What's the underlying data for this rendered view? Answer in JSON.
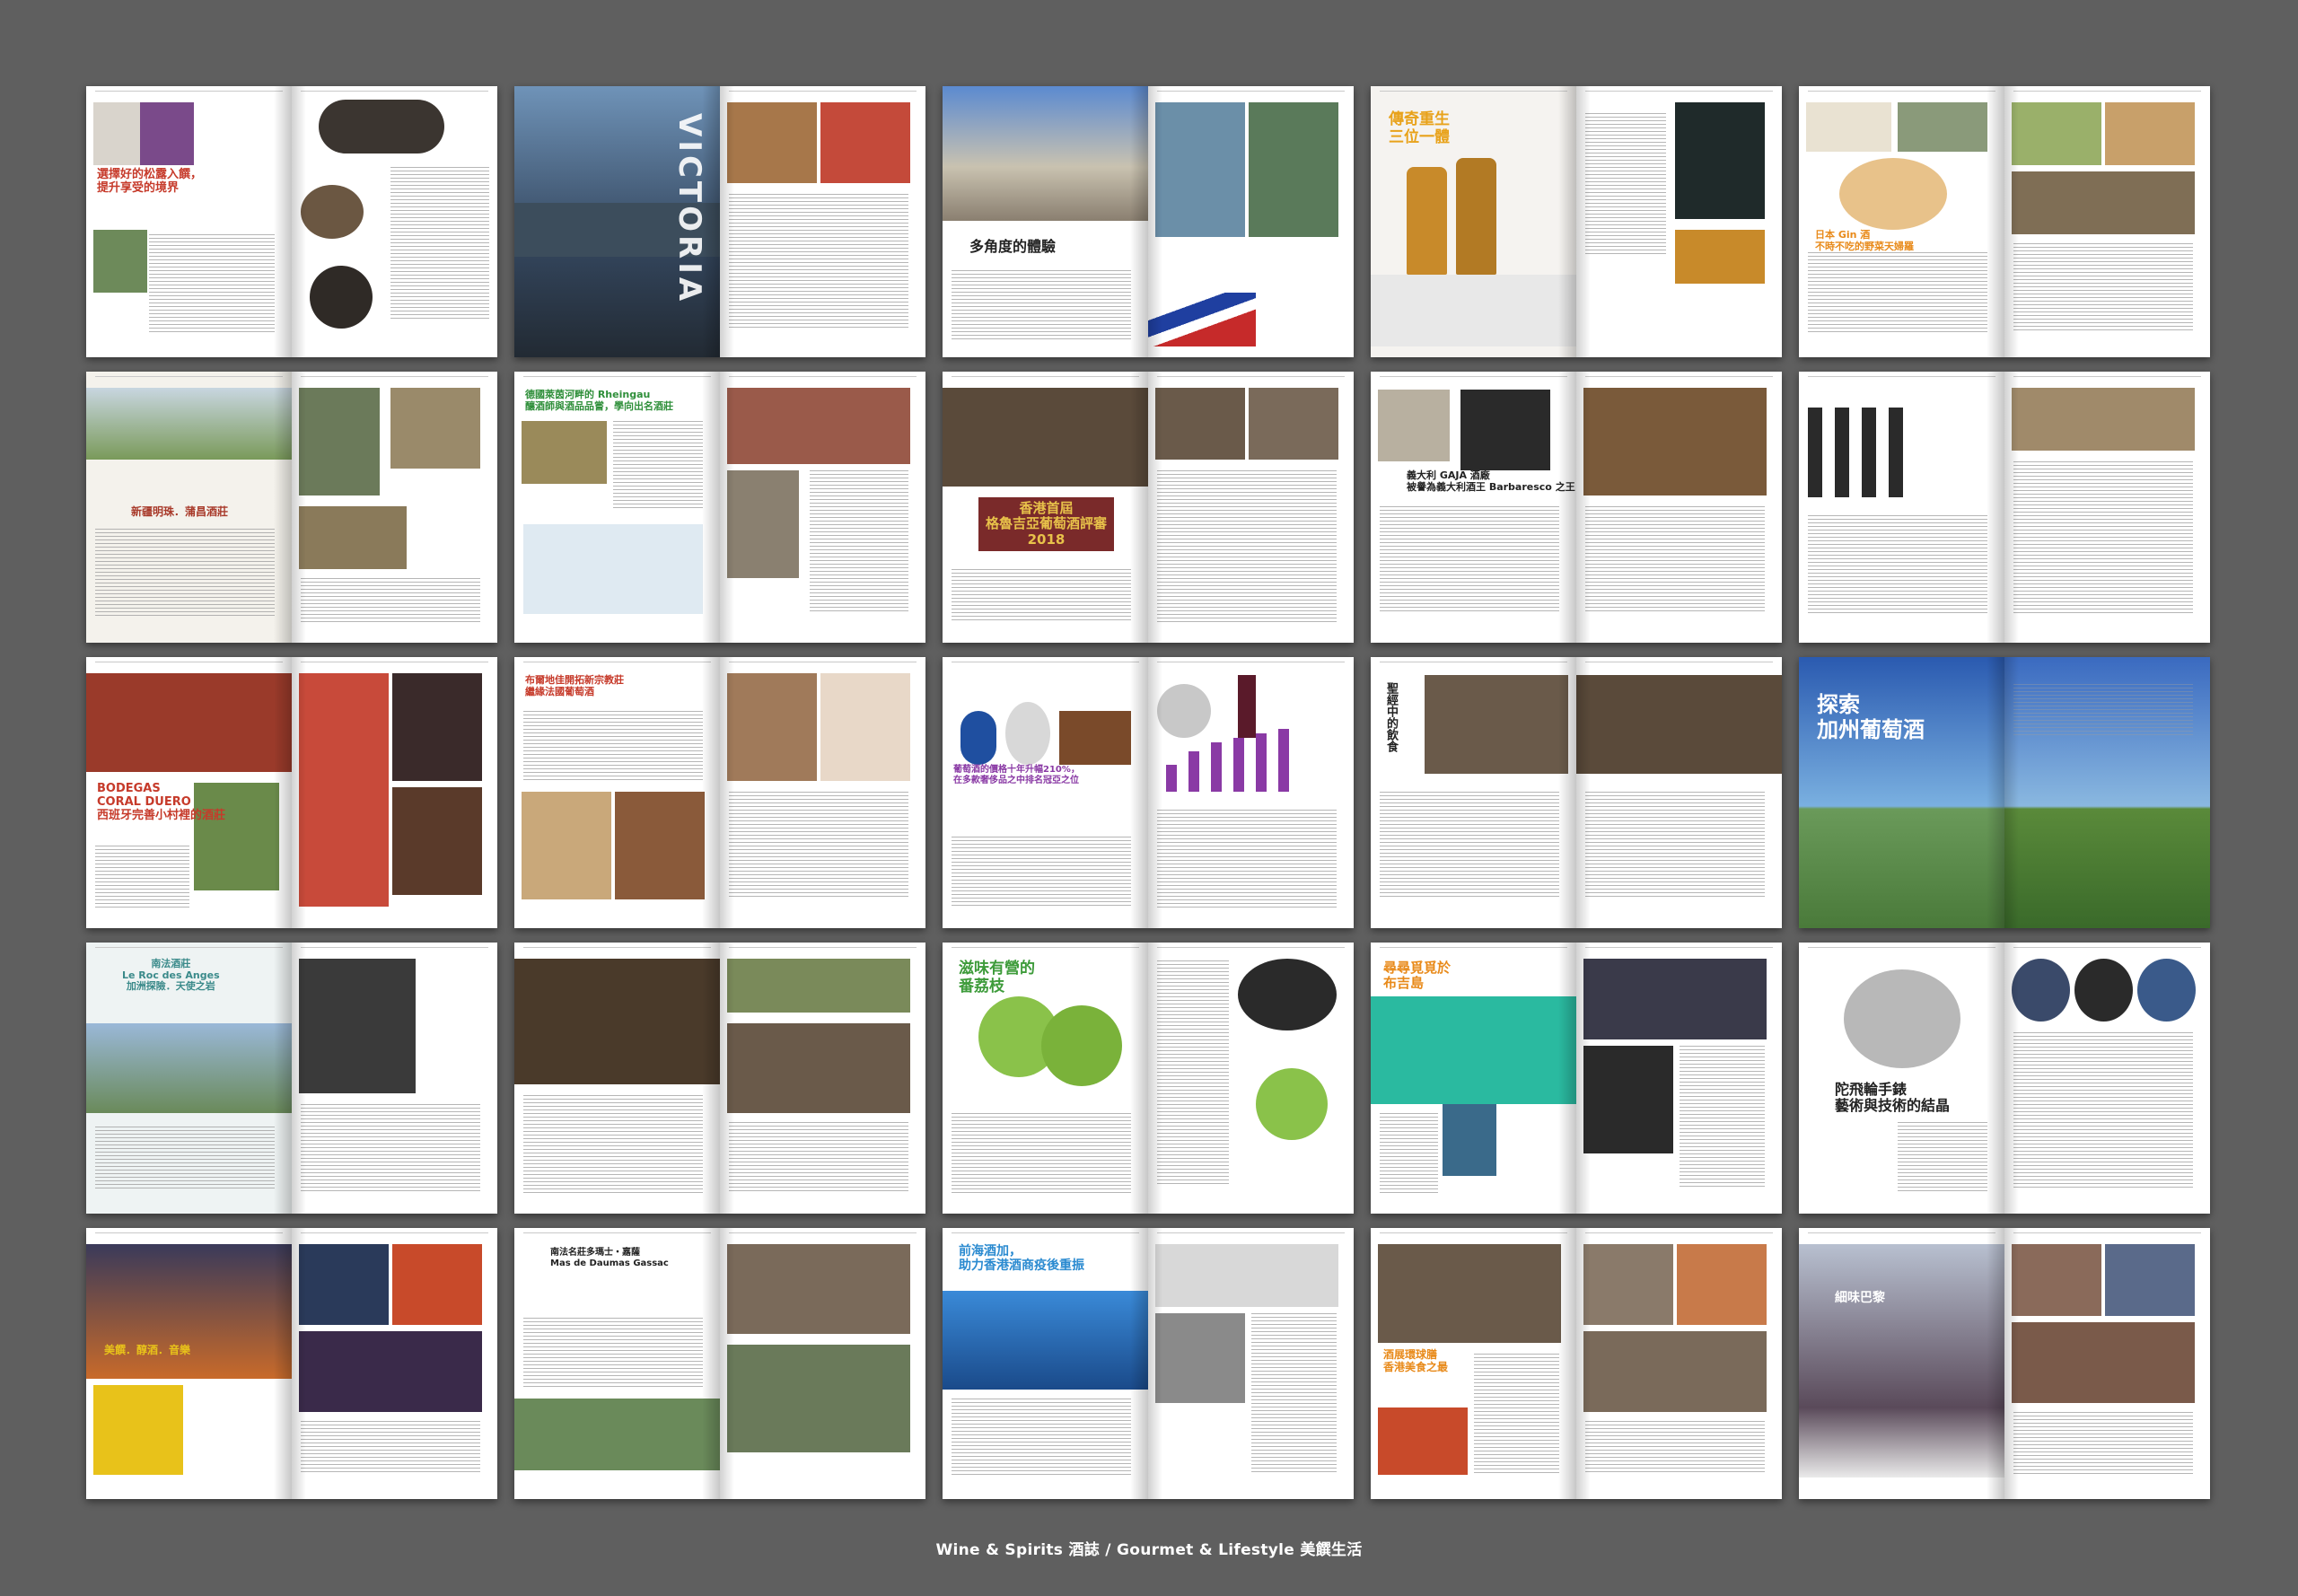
{
  "caption": "Wine & Spirits 酒誌 / Gourmet & Lifestyle 美饌生活",
  "colors": {
    "background": "#5f5f5f",
    "accent_red": "#c63a2a",
    "accent_green": "#3d9b3a",
    "accent_orange": "#e88a1a",
    "accent_blue": "#1f5fb0",
    "accent_purple": "#8a3aa5"
  },
  "spreads": [
    {
      "headline": "選擇好的松露入饌，\n提升享受的境界",
      "headline_color": "#c63a2a",
      "theme": "truffle"
    },
    {
      "headline": "VICTORIA",
      "headline_color": "#ffffff",
      "theme": "victoria"
    },
    {
      "headline": "多角度的體驗",
      "headline_color": "#222222",
      "theme": "bordeaux"
    },
    {
      "headline": "傳奇重生\n三位一體",
      "headline_color": "#e8a21a",
      "theme": "whisky"
    },
    {
      "headline": "日本 Gin 酒\n不時不吃的野菜天婦羅",
      "headline_color": "#e88a1a",
      "theme": "gin"
    },
    {
      "headline": "新疆明珠．蒲昌酒莊",
      "headline_color": "#a83a2a",
      "theme": "xinjiang"
    },
    {
      "headline": "德國萊茵河畔的 Rheingau\n釀酒師與酒品品嘗，學向出名酒莊",
      "headline_color": "#2f8f3a",
      "theme": "rheingau"
    },
    {
      "headline": "香港首屆\n格魯吉亞葡萄酒評審\n2018",
      "headline_color": "#e8c24a",
      "theme": "georgia"
    },
    {
      "headline": "義大利 GAJA 酒廠\n被譽為義大利酒王 Barbaresco 之王",
      "headline_color": "#222222",
      "theme": "gaja"
    },
    {
      "headline": "",
      "headline_color": "#222222",
      "theme": "gaja2"
    },
    {
      "headline": "BODEGAS\nCORAL DUERO\n西班牙完善小村裡的酒莊",
      "headline_color": "#c63a2a",
      "theme": "coral"
    },
    {
      "headline": "布爾地佳開拓新宗教莊\n繼緣法國葡萄酒",
      "headline_color": "#c63a2a",
      "theme": "french"
    },
    {
      "headline": "葡萄酒的價格十年升幅210%，\n在多款奢侈品之中排名冠亞之位",
      "headline_color": "#8a3aa5",
      "theme": "tenyear"
    },
    {
      "headline": "聖經中的飲食",
      "headline_color": "#222222",
      "theme": "bible"
    },
    {
      "headline": "探索\n加州葡萄酒",
      "headline_color": "#ffffff",
      "theme": "california"
    },
    {
      "headline": "南法酒莊\nLe Roc des Anges\n加洲探險．天使之岩",
      "headline_color": "#3a8a8a",
      "theme": "rocanges"
    },
    {
      "headline": "",
      "headline_color": "#222222",
      "theme": "cellar"
    },
    {
      "headline": "滋味有營的\n番荔枝",
      "headline_color": "#3d9b3a",
      "theme": "custard"
    },
    {
      "headline": "尋尋覓覓於\n布吉島",
      "headline_color": "#e88a1a",
      "theme": "phuket"
    },
    {
      "headline": "陀飛輪手錶\n藝術與技術的結晶",
      "headline_color": "#222222",
      "theme": "watch"
    },
    {
      "headline": "美饌．醇酒．音樂",
      "headline_color": "#e8c21a",
      "theme": "night"
    },
    {
      "headline": "南法名莊多瑪士・嘉薩\nMas de Daumas Gassac",
      "headline_color": "#222222",
      "theme": "daumas"
    },
    {
      "headline": "前海酒加，\n助力香港酒商疫後重振",
      "headline_color": "#2a8ad0",
      "theme": "qianhai"
    },
    {
      "headline": "酒展環球膳\n香港美食之最",
      "headline_color": "#e88a1a",
      "theme": "expo"
    },
    {
      "headline": "細味巴黎",
      "headline_color": "#ffffff",
      "theme": "paris"
    }
  ]
}
